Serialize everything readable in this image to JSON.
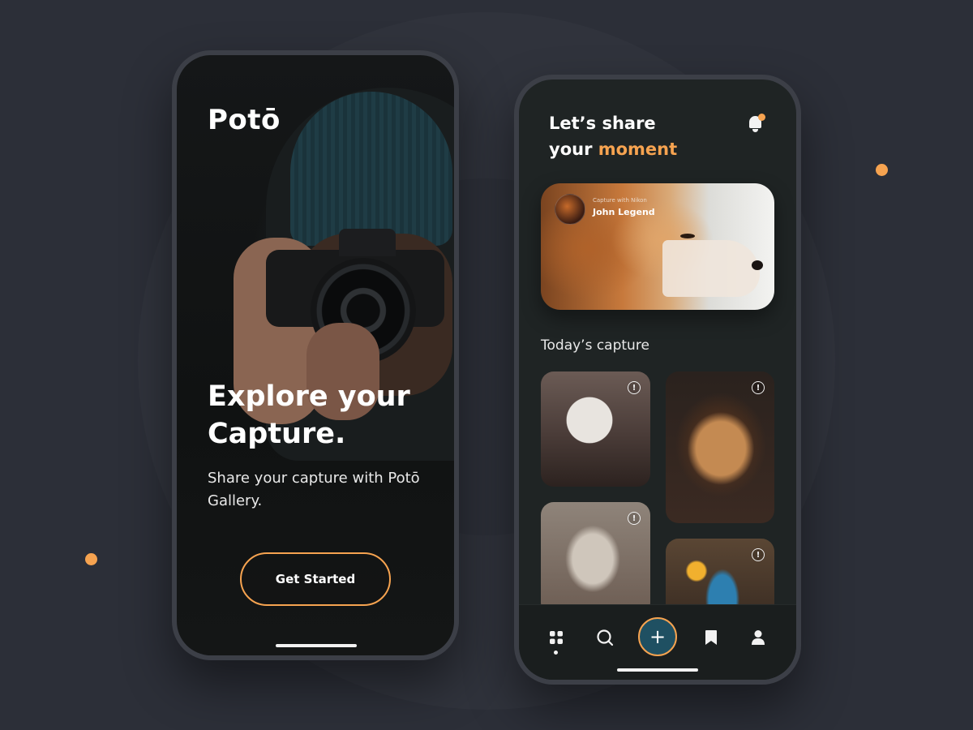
{
  "colors": {
    "background": "#2c2f38",
    "accent": "#f6a350",
    "screen_dark": "#1f2424",
    "fab_fill": "#1f5062",
    "text_primary": "#ffffff"
  },
  "onboarding": {
    "logo": "Potō",
    "headline": "Explore your Capture.",
    "subtitle": "Share your capture with Potō Gallery.",
    "cta_label": "Get Started"
  },
  "feed": {
    "greeting_line1": "Let’s share",
    "greeting_line2_prefix": "your ",
    "greeting_highlight": "moment",
    "featured": {
      "caption": "Capture with Nikon",
      "author": "John Legend"
    },
    "section_title": "Today’s capture",
    "info_glyph": "!",
    "tabs": {
      "home_icon": "grid-icon",
      "search_icon": "search-icon",
      "add_label": "+",
      "bookmark_icon": "bookmark-icon",
      "profile_icon": "user-icon"
    }
  }
}
